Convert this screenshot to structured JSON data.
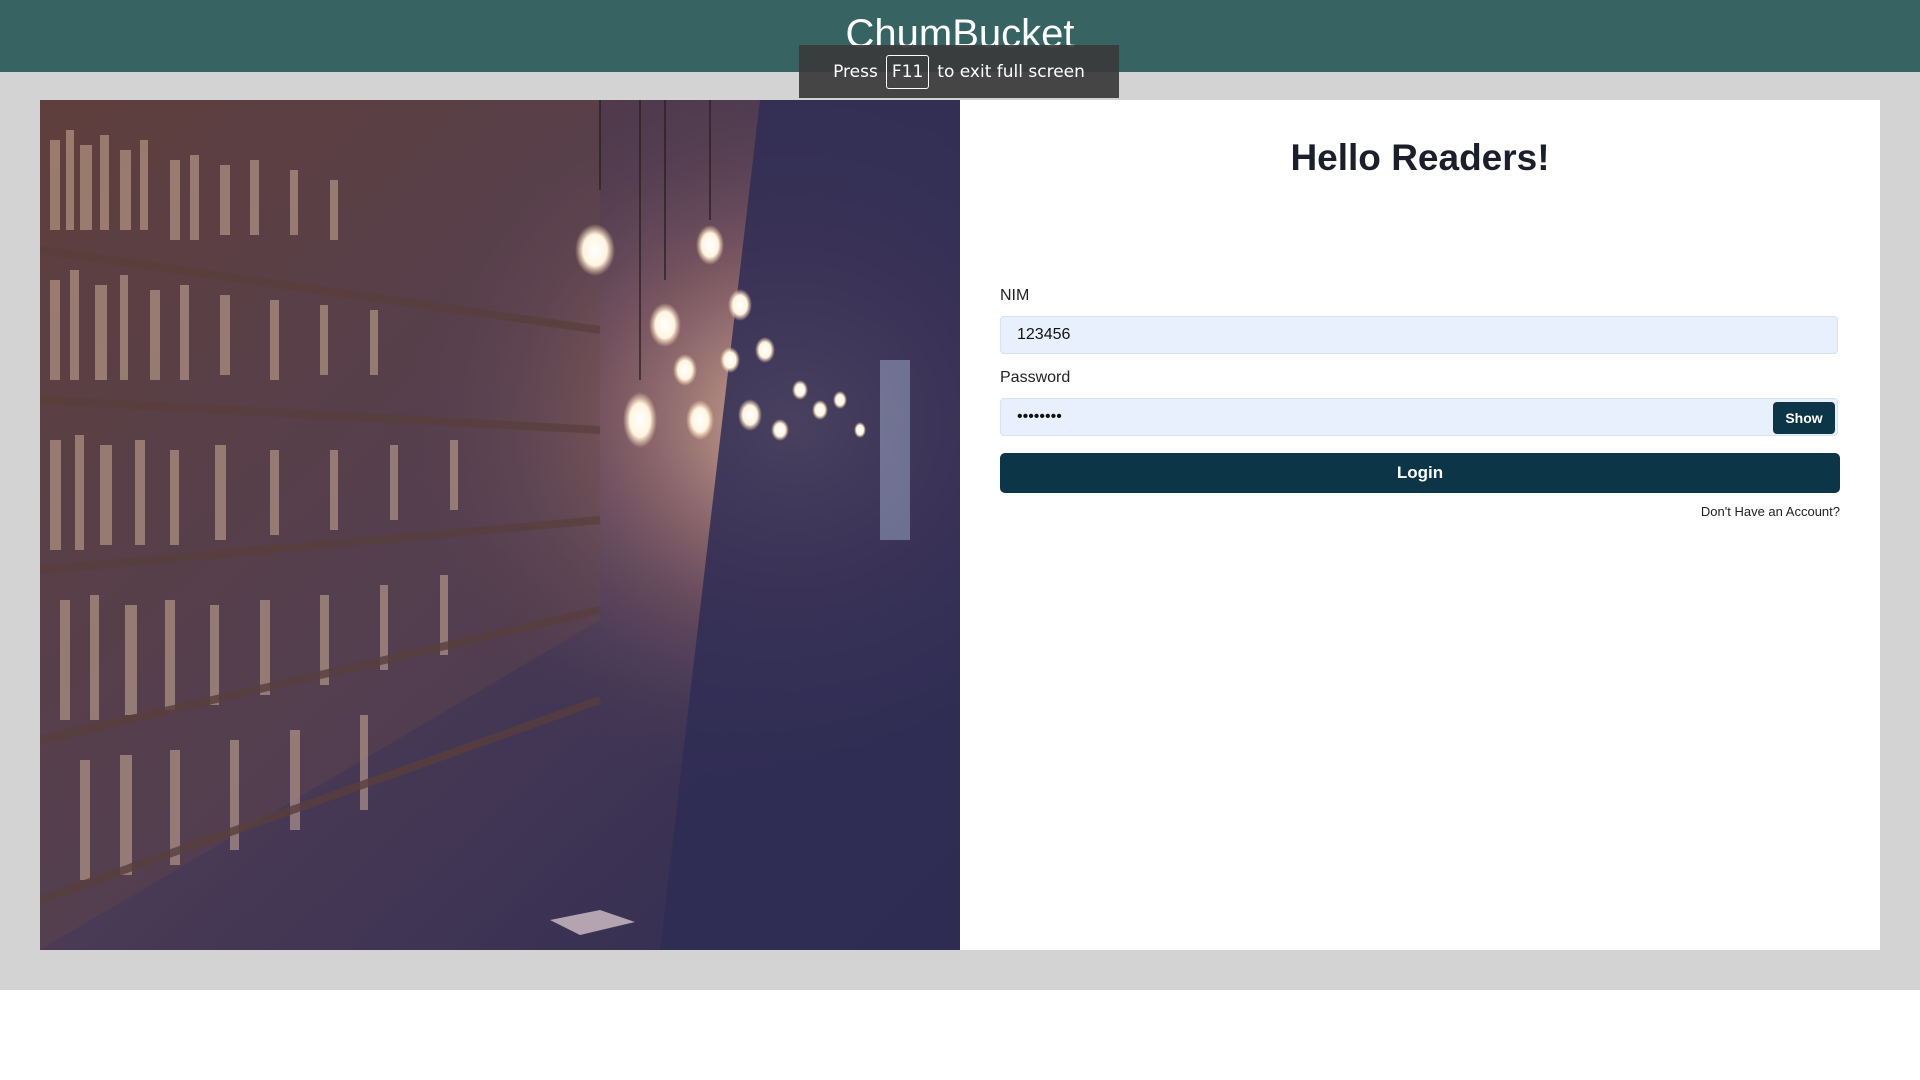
{
  "header": {
    "brand": "ChumBucket"
  },
  "fullscreen_notice": {
    "before": "Press",
    "key": "F11",
    "after": "to exit full screen"
  },
  "login": {
    "greeting": "Hello Readers!",
    "nim_label": "NIM",
    "nim_value": "123456",
    "password_label": "Password",
    "password_value": "••••••••",
    "show_label": "Show",
    "login_label": "Login",
    "signup_link": "Don't Have an Account?"
  },
  "colors": {
    "header_bg": "#376463",
    "page_bg": "#d3d3d3",
    "button_bg": "#0c3547",
    "input_bg": "#e8f0fe"
  }
}
